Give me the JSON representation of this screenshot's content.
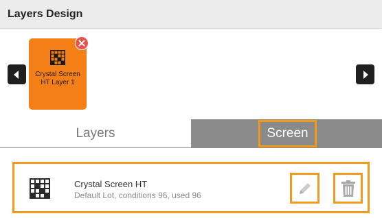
{
  "header": {
    "title": "Layers Design"
  },
  "carousel": {
    "prev_icon": "chevron-left-icon",
    "next_icon": "chevron-right-icon",
    "selected_layer": {
      "label": "Crystal Screen HT Layer 1",
      "icon": "grid-icon",
      "remove_icon": "close-icon",
      "color": "#f57f17"
    }
  },
  "tabs": [
    {
      "label": "Layers",
      "active": false
    },
    {
      "label": "Screen",
      "active": true
    }
  ],
  "screen_list": [
    {
      "icon": "grid-icon",
      "title": "Crystal Screen HT",
      "subtitle": "Default Lot, conditions 96, used 96",
      "edit_icon": "pencil-icon",
      "delete_icon": "trash-icon"
    }
  ],
  "colors": {
    "accent": "#f29a1c",
    "card": "#f57f17",
    "tab_active_bg": "#8a8a8a",
    "remove_badge": "#e8534a"
  }
}
